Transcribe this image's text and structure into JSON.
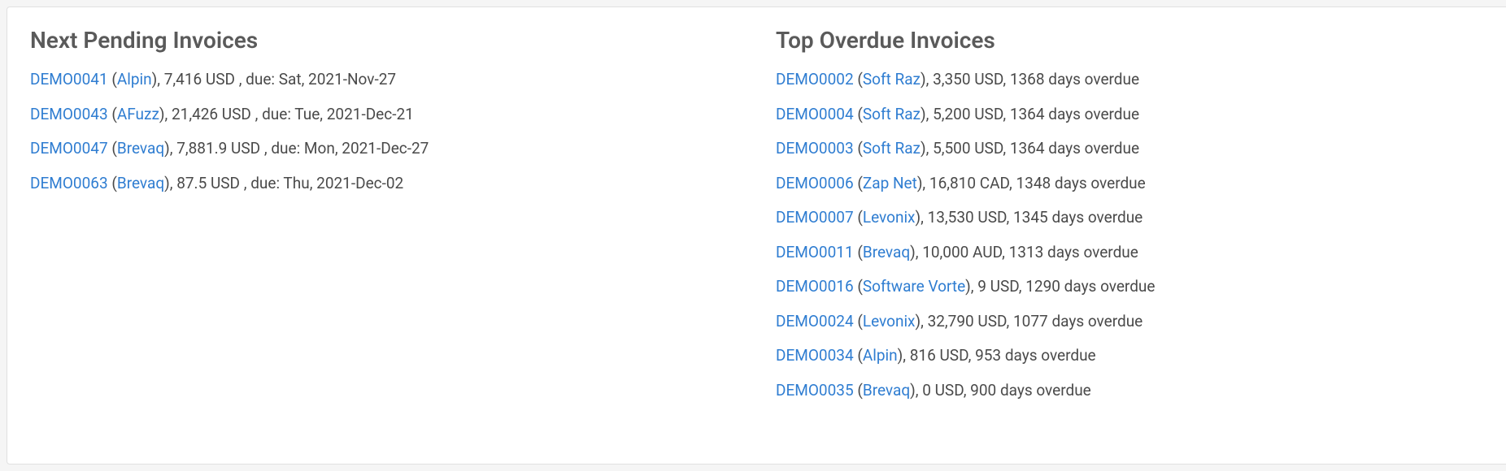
{
  "pending": {
    "title": "Next Pending Invoices",
    "items": [
      {
        "invoice": "DEMO0041",
        "customer": "Alpin",
        "amount": "7,416 USD",
        "due": "Sat, 2021-Nov-27"
      },
      {
        "invoice": "DEMO0043",
        "customer": "AFuzz",
        "amount": "21,426 USD",
        "due": "Tue, 2021-Dec-21"
      },
      {
        "invoice": "DEMO0047",
        "customer": "Brevaq",
        "amount": "7,881.9 USD",
        "due": "Mon, 2021-Dec-27"
      },
      {
        "invoice": "DEMO0063",
        "customer": "Brevaq",
        "amount": "87.5 USD",
        "due": "Thu, 2021-Dec-02"
      }
    ]
  },
  "overdue": {
    "title": "Top Overdue Invoices",
    "items": [
      {
        "invoice": "DEMO0002",
        "customer": "Soft Raz",
        "amount": "3,350 USD",
        "days": "1368"
      },
      {
        "invoice": "DEMO0004",
        "customer": "Soft Raz",
        "amount": "5,200 USD",
        "days": "1364"
      },
      {
        "invoice": "DEMO0003",
        "customer": "Soft Raz",
        "amount": "5,500 USD",
        "days": "1364"
      },
      {
        "invoice": "DEMO0006",
        "customer": "Zap Net",
        "amount": "16,810 CAD",
        "days": "1348"
      },
      {
        "invoice": "DEMO0007",
        "customer": "Levonix",
        "amount": "13,530 USD",
        "days": "1345"
      },
      {
        "invoice": "DEMO0011",
        "customer": "Brevaq",
        "amount": "10,000 AUD",
        "days": "1313"
      },
      {
        "invoice": "DEMO0016",
        "customer": "Software Vorte",
        "amount": "9 USD",
        "days": "1290"
      },
      {
        "invoice": "DEMO0024",
        "customer": "Levonix",
        "amount": "32,790 USD",
        "days": "1077"
      },
      {
        "invoice": "DEMO0034",
        "customer": "Alpin",
        "amount": "816 USD",
        "days": "953"
      },
      {
        "invoice": "DEMO0035",
        "customer": "Brevaq",
        "amount": "0 USD",
        "days": "900"
      }
    ]
  },
  "labels": {
    "due_prefix": "due:",
    "overdue_suffix": "days overdue"
  }
}
